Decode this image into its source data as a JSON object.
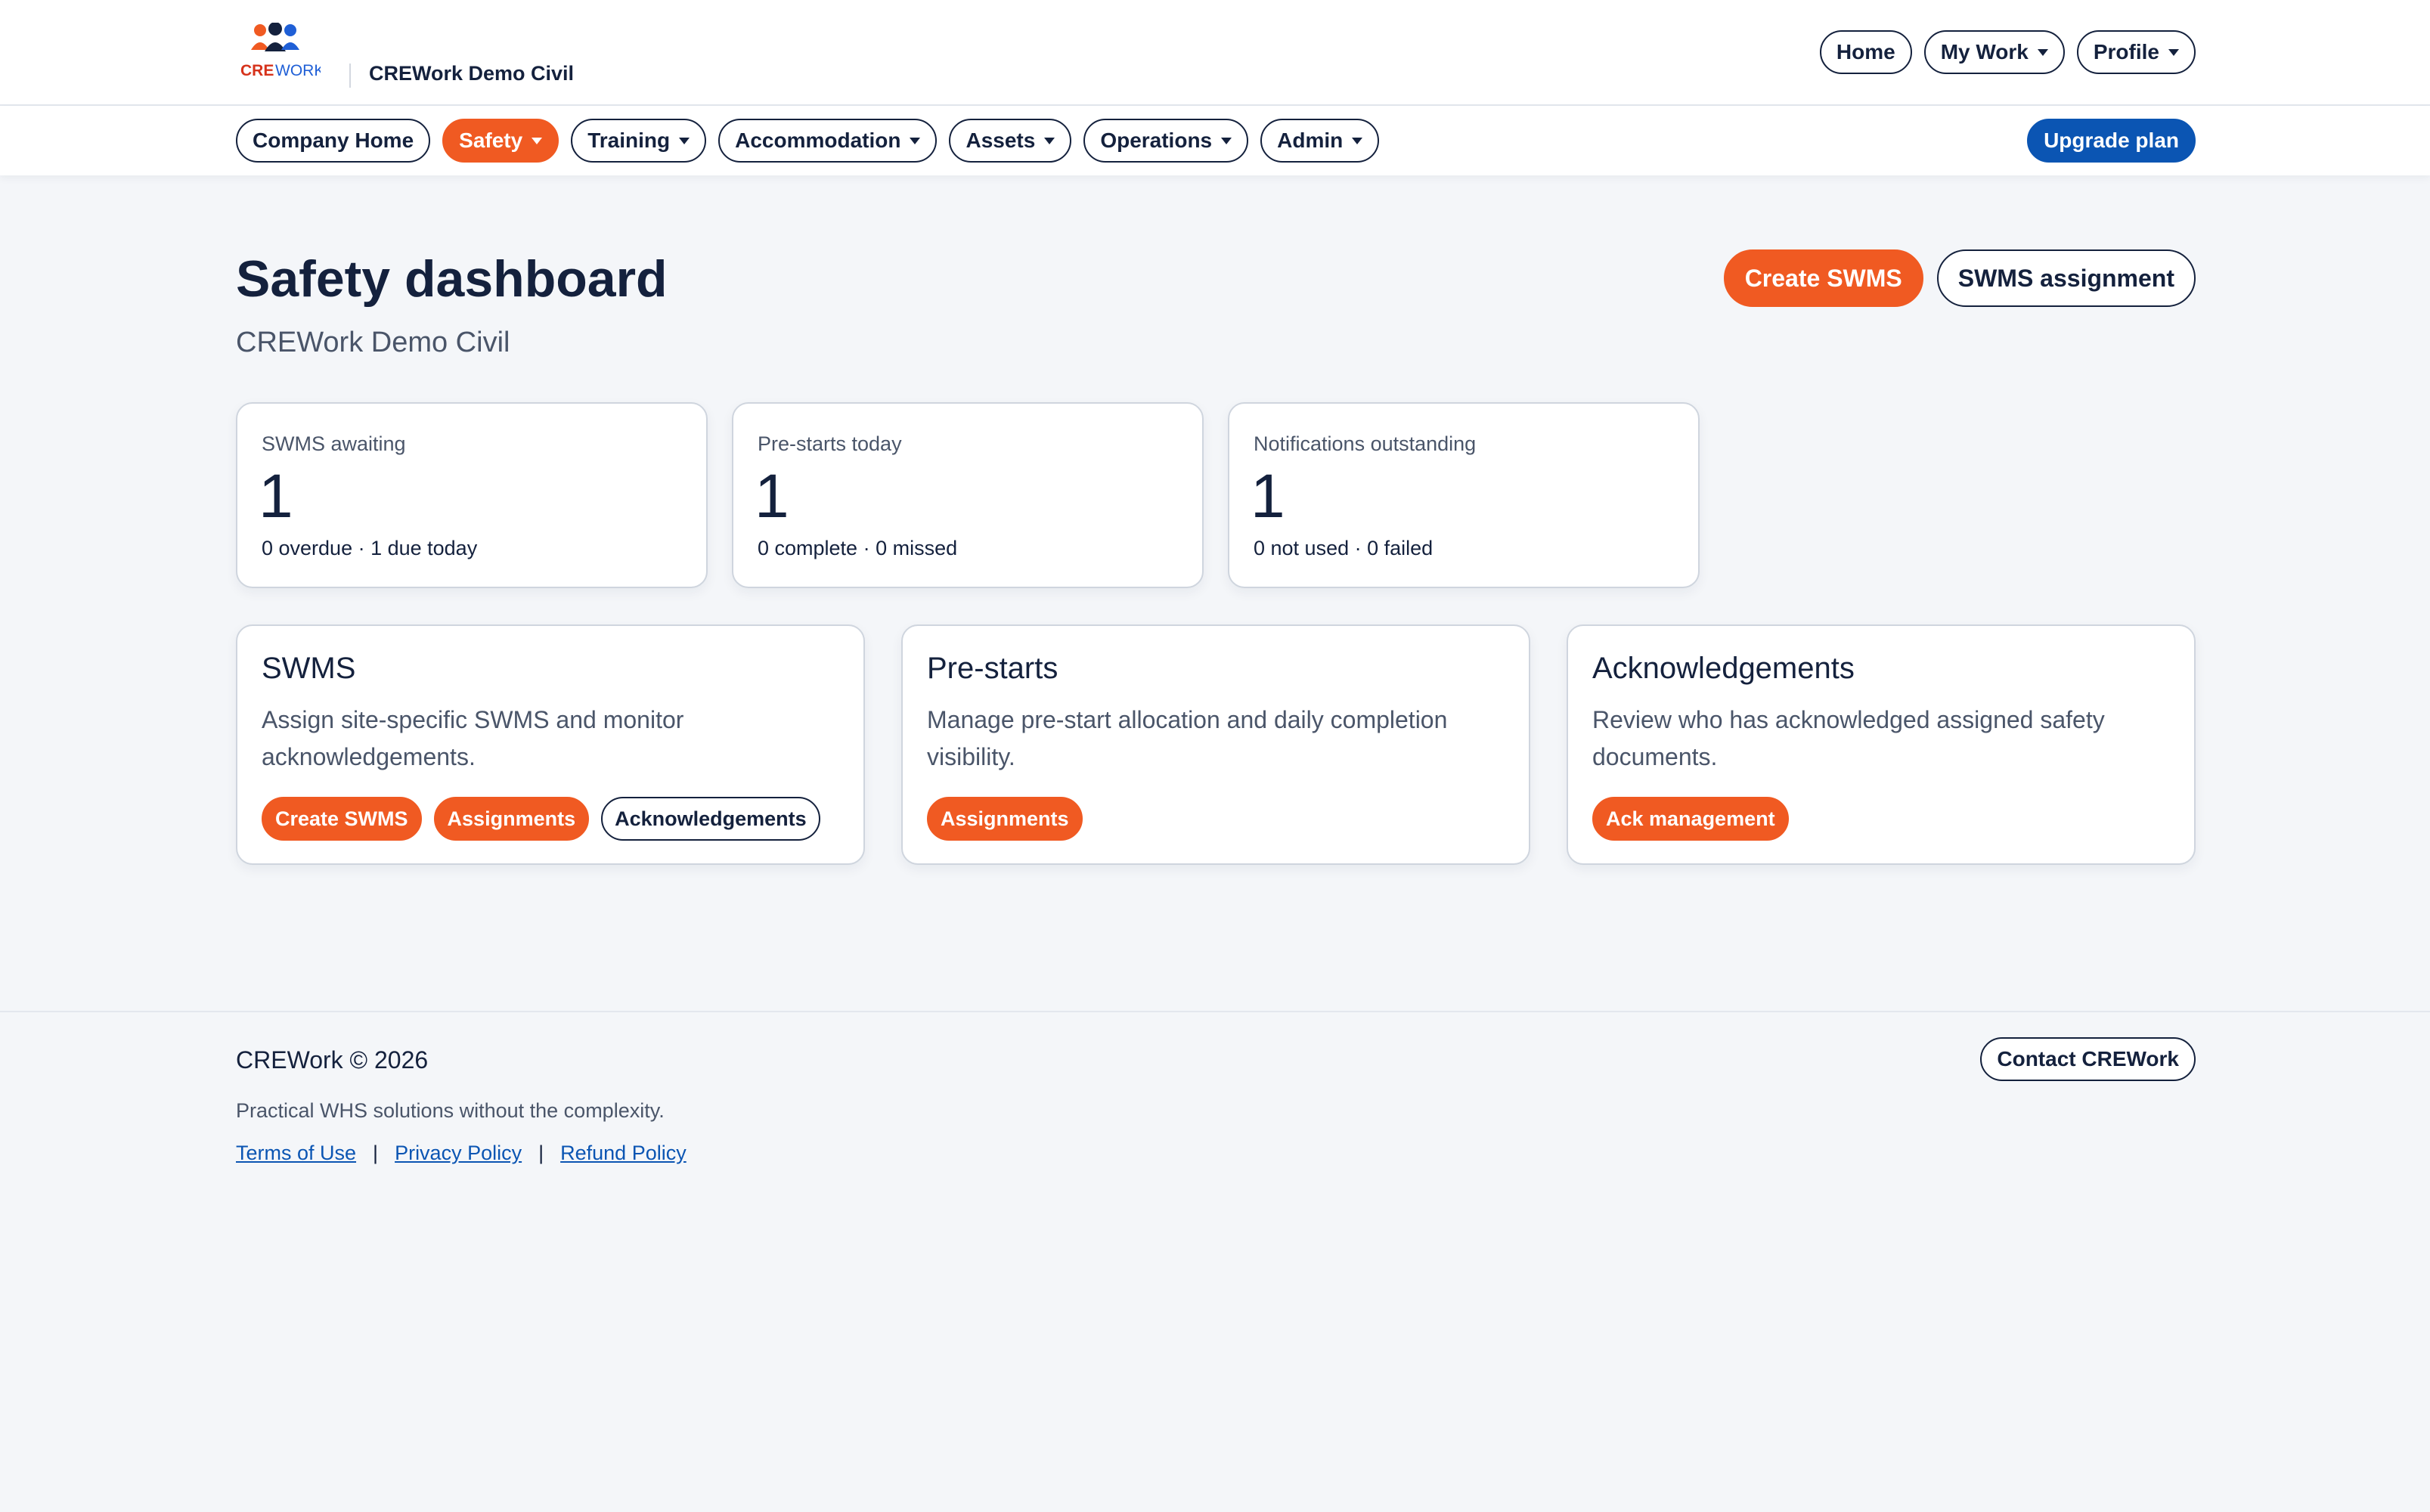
{
  "brand": {
    "logo_text_cre": "CRE",
    "logo_text_work": "WORK",
    "company_name": "CREWork Demo Civil",
    "colors": {
      "orange": "#f05a22",
      "navy": "#14213d",
      "blue": "#0b55b3"
    }
  },
  "top_nav": {
    "home": "Home",
    "my_work": "My Work",
    "profile": "Profile"
  },
  "main_nav": {
    "items": [
      {
        "label": "Company Home",
        "dropdown": false,
        "active": false
      },
      {
        "label": "Safety",
        "dropdown": true,
        "active": true
      },
      {
        "label": "Training",
        "dropdown": true,
        "active": false
      },
      {
        "label": "Accommodation",
        "dropdown": true,
        "active": false
      },
      {
        "label": "Assets",
        "dropdown": true,
        "active": false
      },
      {
        "label": "Operations",
        "dropdown": true,
        "active": false
      },
      {
        "label": "Admin",
        "dropdown": true,
        "active": false
      }
    ],
    "upgrade": "Upgrade plan"
  },
  "header": {
    "title": "Safety dashboard",
    "subtitle": "CREWork Demo Civil",
    "create_swms": "Create SWMS",
    "swms_assignment": "SWMS assignment"
  },
  "stats": [
    {
      "label": "SWMS awaiting",
      "value": "1",
      "meta": "0 overdue · 1 due today"
    },
    {
      "label": "Pre-starts today",
      "value": "1",
      "meta": "0 complete · 0 missed"
    },
    {
      "label": "Notifications outstanding",
      "value": "1",
      "meta": "0 not used · 0 failed"
    }
  ],
  "cards": [
    {
      "title": "SWMS",
      "description": "Assign site-specific SWMS and monitor acknowledgements.",
      "actions": [
        "Create SWMS",
        "Assignments",
        "Acknowledgements"
      ]
    },
    {
      "title": "Pre-starts",
      "description": "Manage pre-start allocation and daily completion visibility.",
      "actions": [
        "Assignments"
      ]
    },
    {
      "title": "Acknowledgements",
      "description": "Review who has acknowledged assigned safety documents.",
      "actions": [
        "Ack management"
      ]
    }
  ],
  "footer": {
    "copyright": "CREWork © 2026",
    "tagline": "Practical WHS solutions without the complexity.",
    "terms": "Terms of Use",
    "privacy": "Privacy Policy",
    "refund": "Refund Policy",
    "separator": "|",
    "contact": "Contact CREWork"
  }
}
